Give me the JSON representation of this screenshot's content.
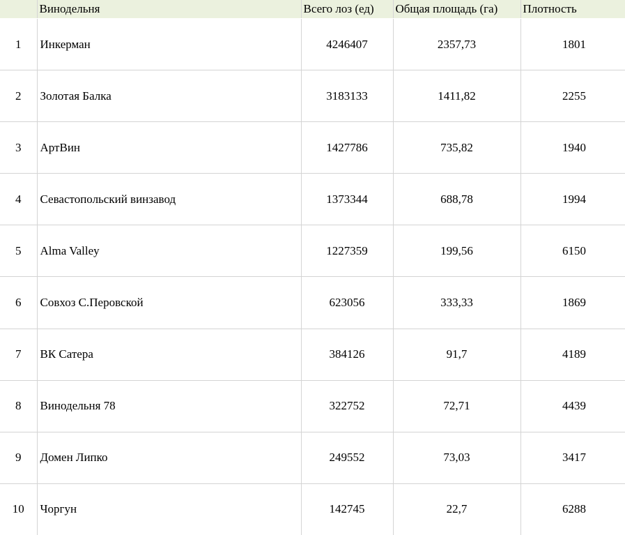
{
  "table": {
    "headers": {
      "num": "",
      "name": "Винодельня",
      "vines": "Всего лоз (ед)",
      "area": "Общая площадь (га)",
      "density": "Плотность"
    },
    "rows": [
      {
        "num": "1",
        "name": "Инкерман",
        "vines": "4246407",
        "area": "2357,73",
        "density": "1801"
      },
      {
        "num": "2",
        "name": "Золотая Балка",
        "vines": "3183133",
        "area": "1411,82",
        "density": "2255"
      },
      {
        "num": "3",
        "name": "АртВин",
        "vines": "1427786",
        "area": "735,82",
        "density": "1940"
      },
      {
        "num": "4",
        "name": "Севастопольский винзавод",
        "vines": "1373344",
        "area": "688,78",
        "density": "1994"
      },
      {
        "num": "5",
        "name": "Alma Valley",
        "vines": "1227359",
        "area": "199,56",
        "density": "6150"
      },
      {
        "num": "6",
        "name": "Совхоз С.Перовской",
        "vines": "623056",
        "area": "333,33",
        "density": "1869"
      },
      {
        "num": "7",
        "name": "ВК Сатера",
        "vines": "384126",
        "area": "91,7",
        "density": "4189"
      },
      {
        "num": "8",
        "name": "Винодельня 78",
        "vines": "322752",
        "area": "72,71",
        "density": "4439"
      },
      {
        "num": "9",
        "name": "Домен Липко",
        "vines": "249552",
        "area": "73,03",
        "density": "3417"
      },
      {
        "num": "10",
        "name": "Чоргун",
        "vines": "142745",
        "area": "22,7",
        "density": "6288"
      }
    ]
  },
  "colors": {
    "header_background": "#ebf1de",
    "gridline": "#d4d4d4"
  }
}
